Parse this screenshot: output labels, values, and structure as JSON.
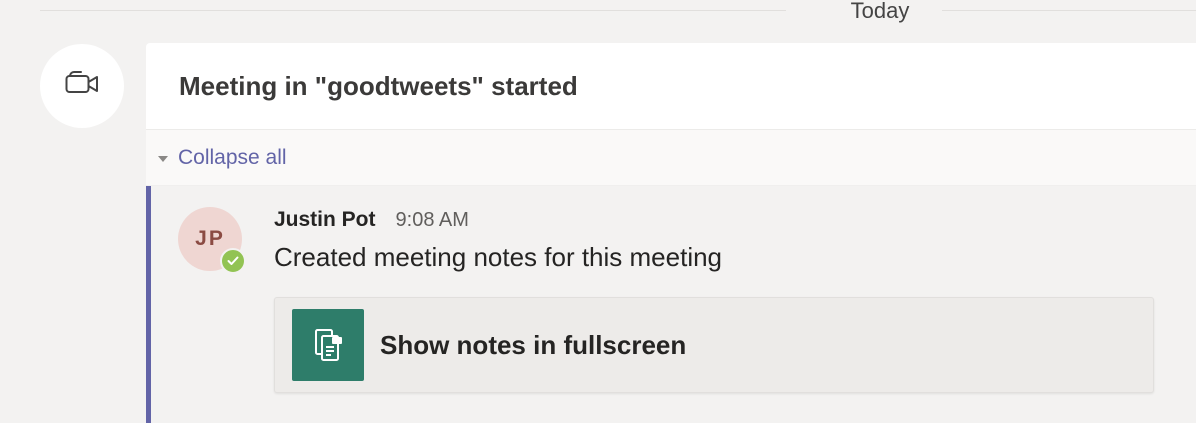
{
  "date_divider": {
    "label": "Today"
  },
  "meeting": {
    "icon": "video-camera-icon",
    "title": "Meeting in \"goodtweets\" started"
  },
  "collapse": {
    "label": "Collapse all",
    "icon": "caret-down-icon"
  },
  "message": {
    "avatar_initials": "JP",
    "presence": "available",
    "author": "Justin Pot",
    "time": "9:08 AM",
    "body": "Created meeting notes for this meeting"
  },
  "notes_card": {
    "icon": "notes-icon",
    "label": "Show notes in fullscreen"
  },
  "colors": {
    "accent": "#6264a7",
    "presence_available": "#92c353",
    "notes_tile": "#2e7d6a",
    "avatar_bg": "#efd6d2"
  }
}
